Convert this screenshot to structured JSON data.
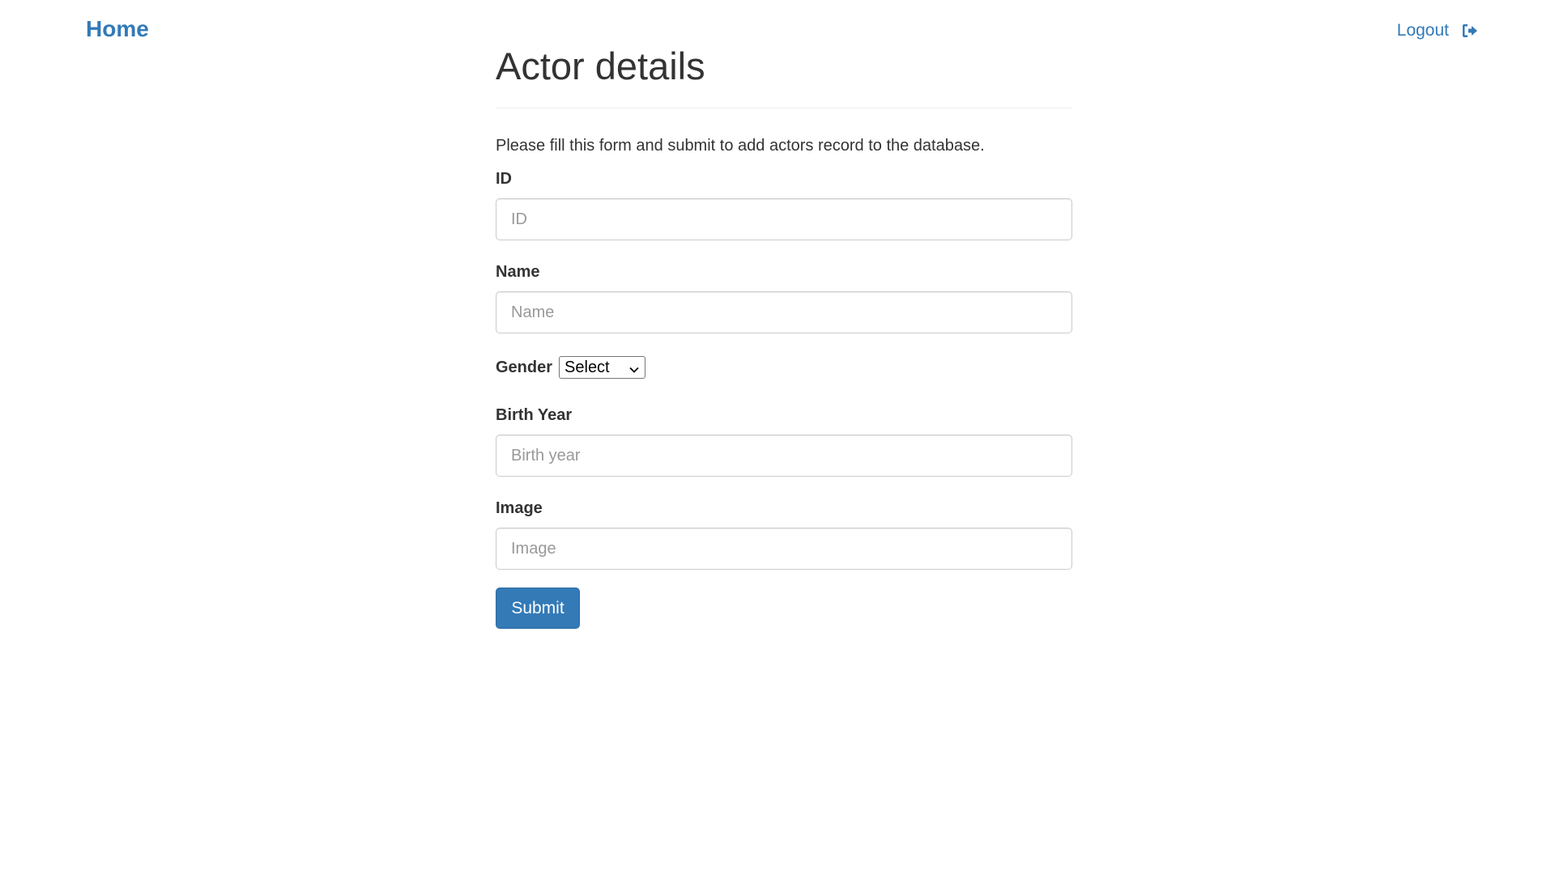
{
  "nav": {
    "home_label": "Home",
    "logout_label": "Logout",
    "logout_icon": "logout-icon"
  },
  "form": {
    "title": "Actor details",
    "intro": "Please fill this form and submit to add actors record to the database.",
    "fields": {
      "id": {
        "label": "ID",
        "placeholder": "ID",
        "value": ""
      },
      "name": {
        "label": "Name",
        "placeholder": "Name",
        "value": ""
      },
      "gender": {
        "label": "Gender",
        "selected": "Select"
      },
      "birth_year": {
        "label": "Birth Year",
        "placeholder": "Birth year",
        "value": ""
      },
      "image": {
        "label": "Image",
        "placeholder": "Image",
        "value": ""
      }
    },
    "submit_label": "Submit"
  },
  "colors": {
    "link": "#337ab7",
    "primary_button": "#337ab7",
    "text": "#333333",
    "input_border": "#cccccc"
  }
}
